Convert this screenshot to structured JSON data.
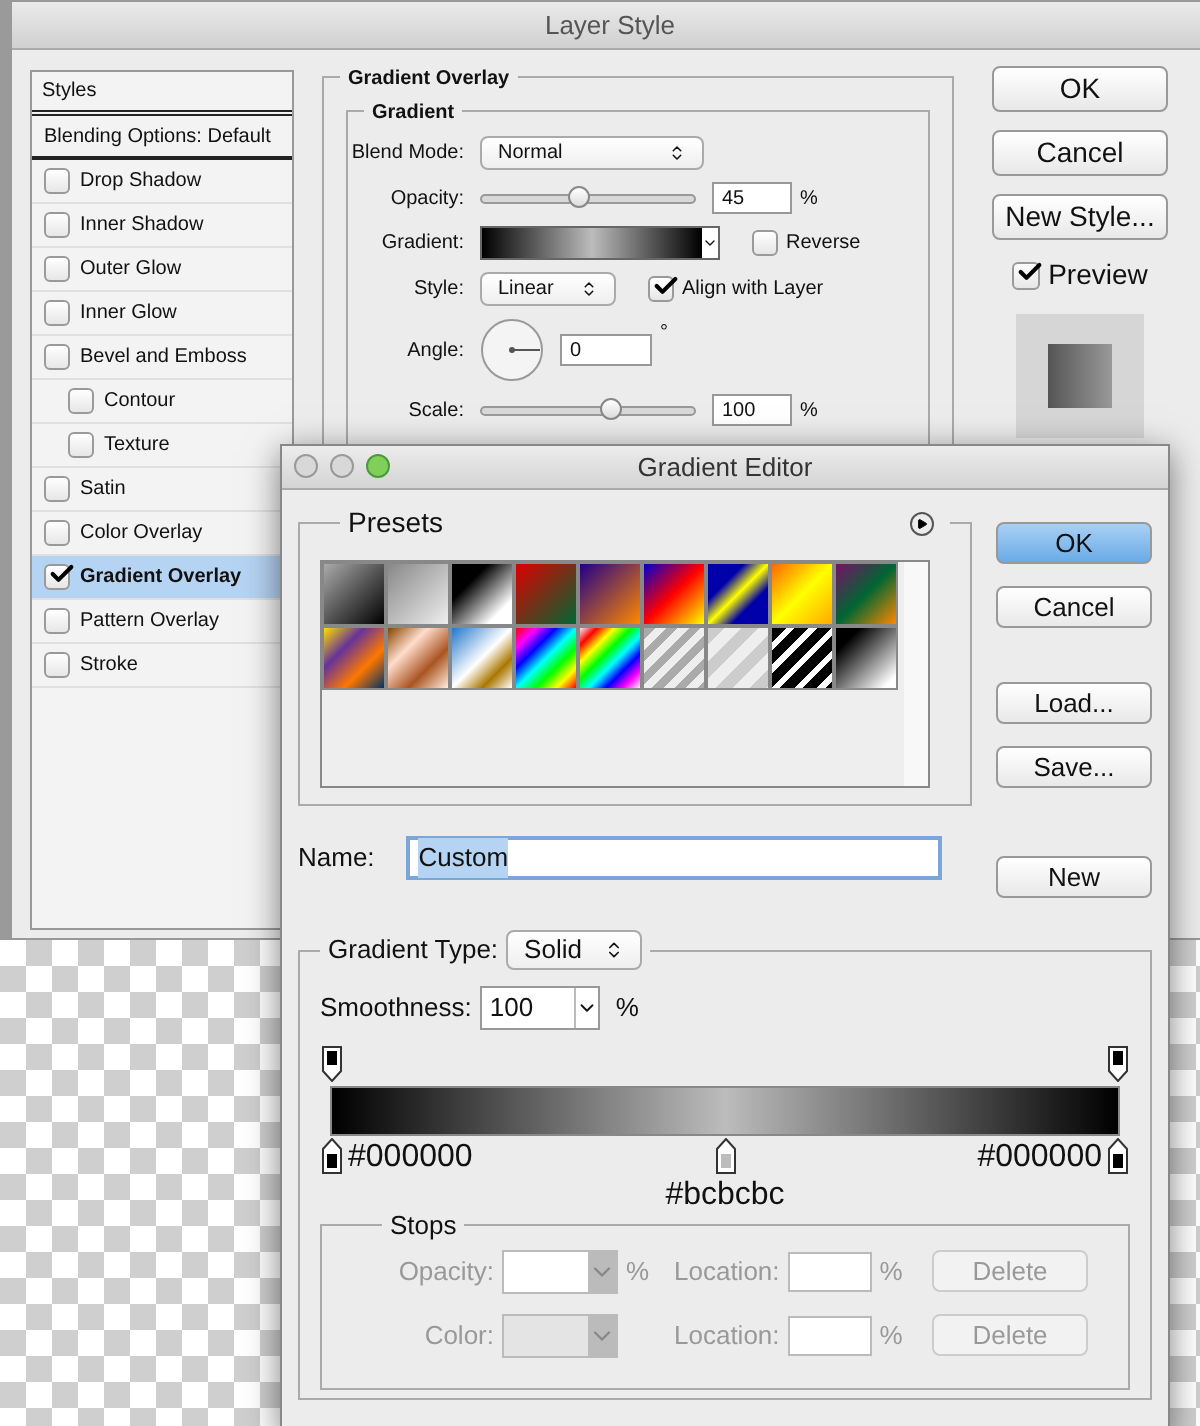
{
  "layer_style": {
    "title": "Layer Style",
    "sidebar": {
      "header": "Styles",
      "items": [
        {
          "kind": "heading",
          "label": "Blending Options: Default",
          "selected": false
        },
        {
          "kind": "check",
          "label": "Drop Shadow",
          "checked": false,
          "selected": false
        },
        {
          "kind": "check",
          "label": "Inner Shadow",
          "checked": false,
          "selected": false
        },
        {
          "kind": "check",
          "label": "Outer Glow",
          "checked": false,
          "selected": false
        },
        {
          "kind": "check",
          "label": "Inner Glow",
          "checked": false,
          "selected": false
        },
        {
          "kind": "check",
          "label": "Bevel and Emboss",
          "checked": false,
          "selected": false,
          "children": [
            {
              "kind": "check",
              "label": "Contour",
              "checked": false,
              "selected": false
            },
            {
              "kind": "check",
              "label": "Texture",
              "checked": false,
              "selected": false
            }
          ]
        },
        {
          "kind": "check",
          "label": "Satin",
          "checked": false,
          "selected": false
        },
        {
          "kind": "check",
          "label": "Color Overlay",
          "checked": false,
          "selected": false
        },
        {
          "kind": "check",
          "label": "Gradient Overlay",
          "checked": true,
          "selected": true
        },
        {
          "kind": "check",
          "label": "Pattern Overlay",
          "checked": false,
          "selected": false
        },
        {
          "kind": "check",
          "label": "Stroke",
          "checked": false,
          "selected": false
        }
      ]
    },
    "section": {
      "title": "Gradient Overlay",
      "group": "Gradient",
      "blend_mode": {
        "label": "Blend Mode:",
        "value": "Normal"
      },
      "opacity": {
        "label": "Opacity:",
        "value": "45",
        "unit": "%",
        "level": 0.45
      },
      "gradient": {
        "label": "Gradient:"
      },
      "reverse": {
        "label": "Reverse",
        "checked": false
      },
      "style": {
        "label": "Style:",
        "value": "Linear"
      },
      "align": {
        "label": "Align with Layer",
        "checked": true
      },
      "angle": {
        "label": "Angle:",
        "value": "0",
        "unit": "°"
      },
      "scale": {
        "label": "Scale:",
        "value": "100",
        "unit": "%",
        "level": 0.6
      }
    },
    "buttons": [
      "OK",
      "Cancel",
      "New Style..."
    ],
    "preview": {
      "label": "Preview",
      "checked": true
    }
  },
  "gradient_editor": {
    "title": "Gradient Editor",
    "presets_title": "Presets",
    "buttons": [
      {
        "label": "OK",
        "default": true
      },
      {
        "label": "Cancel",
        "default": false
      },
      {
        "label": "Load...",
        "default": false
      },
      {
        "label": "Save...",
        "default": false
      }
    ],
    "name": {
      "label": "Name:",
      "value": "Custom"
    },
    "new_button": "New",
    "gradient_type": {
      "label": "Gradient Type:",
      "value": "Solid"
    },
    "smoothness": {
      "label": "Smoothness:",
      "value": "100",
      "unit": "%"
    },
    "opacity_stops": [
      {
        "level": 0
      },
      {
        "level": 1
      }
    ],
    "color_stops": [
      {
        "label": "#000000",
        "color": "#000000",
        "level": 0
      },
      {
        "label": "#bcbcbc",
        "color": "#bcbcbc",
        "level": 0.5
      },
      {
        "label": "#000000",
        "color": "#000000",
        "level": 1
      }
    ],
    "stops": {
      "title": "Stops",
      "disabled": true,
      "rows": [
        {
          "label": "Opacity:",
          "unit": "%",
          "location_label": "Location:",
          "location_unit": "%",
          "button": "Delete"
        },
        {
          "label": "Color:",
          "unit": "",
          "location_label": "Location:",
          "location_unit": "%",
          "button": "Delete"
        }
      ]
    }
  }
}
